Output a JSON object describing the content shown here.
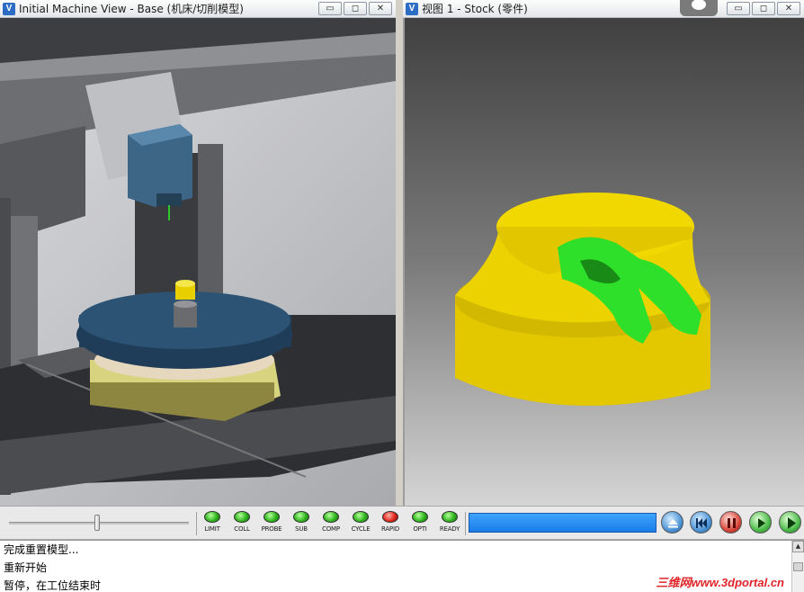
{
  "left_view": {
    "title": "Initial Machine View - Base (机床/切削模型)",
    "app_icon": "V"
  },
  "right_view": {
    "title": "视图 1 - Stock (零件)",
    "app_icon": "V"
  },
  "window_buttons": {
    "minimize": "▭",
    "restore": "◻",
    "close": "✕"
  },
  "status_leds": [
    {
      "label": "LIMIT",
      "color": "green"
    },
    {
      "label": "COLL",
      "color": "green"
    },
    {
      "label": "PROBE",
      "color": "green"
    },
    {
      "label": "SUB",
      "color": "green"
    },
    {
      "label": "COMP",
      "color": "green"
    },
    {
      "label": "CYCLE",
      "color": "green"
    },
    {
      "label": "RAPID",
      "color": "red"
    },
    {
      "label": "OPTI",
      "color": "green"
    },
    {
      "label": "READY",
      "color": "green"
    }
  ],
  "progress": {
    "fraction": 1.0
  },
  "playback": {
    "slider_fraction": 0.49,
    "buttons": [
      "eject-icon",
      "rewind-icon",
      "pause-icon",
      "step-icon",
      "play-icon"
    ]
  },
  "log": {
    "lines": [
      "完成重置模型...",
      "重新开始",
      "暂停，在工位结束时"
    ]
  },
  "watermark": "三维网www.3dportal.cn",
  "colors": {
    "stock_yellow": "#e8d000",
    "cut_green": "#2ee02a",
    "table_blue": "#1f3d58",
    "progress_blue": "#2a8ef2"
  }
}
